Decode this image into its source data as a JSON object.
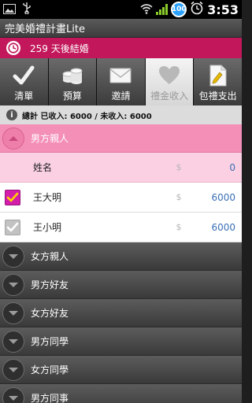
{
  "status": {
    "time": "3:53",
    "battery": "100"
  },
  "app": {
    "title": "完美婚禮計畫Lite"
  },
  "countdown": {
    "text": "259 天後結婚"
  },
  "tabs": [
    {
      "label": "清單",
      "icon": "checkmark-icon",
      "active": false
    },
    {
      "label": "預算",
      "icon": "coins-icon",
      "active": false
    },
    {
      "label": "邀請",
      "icon": "envelope-icon",
      "active": false
    },
    {
      "label": "禮金收入",
      "icon": "heart-icon",
      "active": true
    },
    {
      "label": "包禮支出",
      "icon": "document-icon",
      "active": false
    }
  ],
  "summary": {
    "text": "總計 已收入: 6000 / 未收入: 6000"
  },
  "groups": {
    "open": {
      "label": "男方親人"
    },
    "header": {
      "name": "姓名",
      "currency": "$",
      "amount": "0"
    },
    "people": [
      {
        "name": "王大明",
        "currency": "$",
        "amount": "6000",
        "checked": true
      },
      {
        "name": "王小明",
        "currency": "$",
        "amount": "6000",
        "checked": false
      }
    ],
    "closed": [
      {
        "label": "女方親人"
      },
      {
        "label": "男方好友"
      },
      {
        "label": "女方好友"
      },
      {
        "label": "男方同學"
      },
      {
        "label": "女方同學"
      },
      {
        "label": "男方同事"
      }
    ]
  }
}
